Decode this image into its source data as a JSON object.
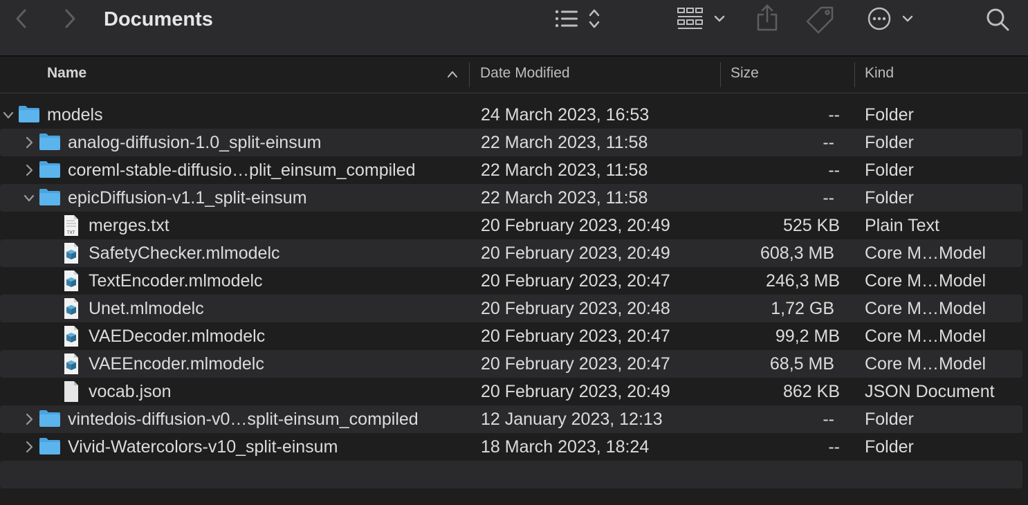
{
  "window": {
    "title": "Documents"
  },
  "toolbar": {
    "icons": [
      "back-arrow-icon",
      "forward-arrow-icon",
      "list-view-icon",
      "sort-updown-icon",
      "grid-view-icon",
      "chevron-down-icon",
      "share-icon",
      "tag-icon",
      "more-options-icon",
      "chevron-down-icon",
      "search-icon"
    ]
  },
  "columns": {
    "name": "Name",
    "date": "Date Modified",
    "size": "Size",
    "kind": "Kind"
  },
  "rows": [
    {
      "name": "models",
      "date": "24 March 2023, 16:53",
      "size": "--",
      "kind": "Folder",
      "type": "folder",
      "level": 0,
      "disclosure": "open"
    },
    {
      "name": "analog-diffusion-1.0_split-einsum",
      "date": "22 March 2023, 11:58",
      "size": "--",
      "kind": "Folder",
      "type": "folder",
      "level": 1,
      "disclosure": "closed"
    },
    {
      "name": "coreml-stable-diffusio…plit_einsum_compiled",
      "date": "22 March 2023, 11:58",
      "size": "--",
      "kind": "Folder",
      "type": "folder",
      "level": 1,
      "disclosure": "closed"
    },
    {
      "name": "epicDiffusion-v1.1_split-einsum",
      "date": "22 March 2023, 11:58",
      "size": "--",
      "kind": "Folder",
      "type": "folder",
      "level": 1,
      "disclosure": "open"
    },
    {
      "name": "merges.txt",
      "date": "20 February 2023, 20:49",
      "size": "525 KB",
      "kind": "Plain Text",
      "type": "txt",
      "level": 2,
      "disclosure": "none"
    },
    {
      "name": "SafetyChecker.mlmodelc",
      "date": "20 February 2023, 20:49",
      "size": "608,3 MB",
      "kind": "Core M…Model",
      "type": "mlmodel",
      "level": 2,
      "disclosure": "none"
    },
    {
      "name": "TextEncoder.mlmodelc",
      "date": "20 February 2023, 20:47",
      "size": "246,3 MB",
      "kind": "Core M…Model",
      "type": "mlmodel",
      "level": 2,
      "disclosure": "none"
    },
    {
      "name": "Unet.mlmodelc",
      "date": "20 February 2023, 20:48",
      "size": "1,72 GB",
      "kind": "Core M…Model",
      "type": "mlmodel",
      "level": 2,
      "disclosure": "none"
    },
    {
      "name": "VAEDecoder.mlmodelc",
      "date": "20 February 2023, 20:47",
      "size": "99,2 MB",
      "kind": "Core M…Model",
      "type": "mlmodel",
      "level": 2,
      "disclosure": "none"
    },
    {
      "name": "VAEEncoder.mlmodelc",
      "date": "20 February 2023, 20:47",
      "size": "68,5 MB",
      "kind": "Core M…Model",
      "type": "mlmodel",
      "level": 2,
      "disclosure": "none"
    },
    {
      "name": "vocab.json",
      "date": "20 February 2023, 20:49",
      "size": "862 KB",
      "kind": "JSON Document",
      "type": "json",
      "level": 2,
      "disclosure": "none"
    },
    {
      "name": "vintedois-diffusion-v0…split-einsum_compiled",
      "date": "12 January 2023, 12:13",
      "size": "--",
      "kind": "Folder",
      "type": "folder",
      "level": 1,
      "disclosure": "closed"
    },
    {
      "name": "Vivid-Watercolors-v10_split-einsum",
      "date": "18 March 2023, 18:24",
      "size": "--",
      "kind": "Folder",
      "type": "folder",
      "level": 1,
      "disclosure": "closed"
    }
  ]
}
